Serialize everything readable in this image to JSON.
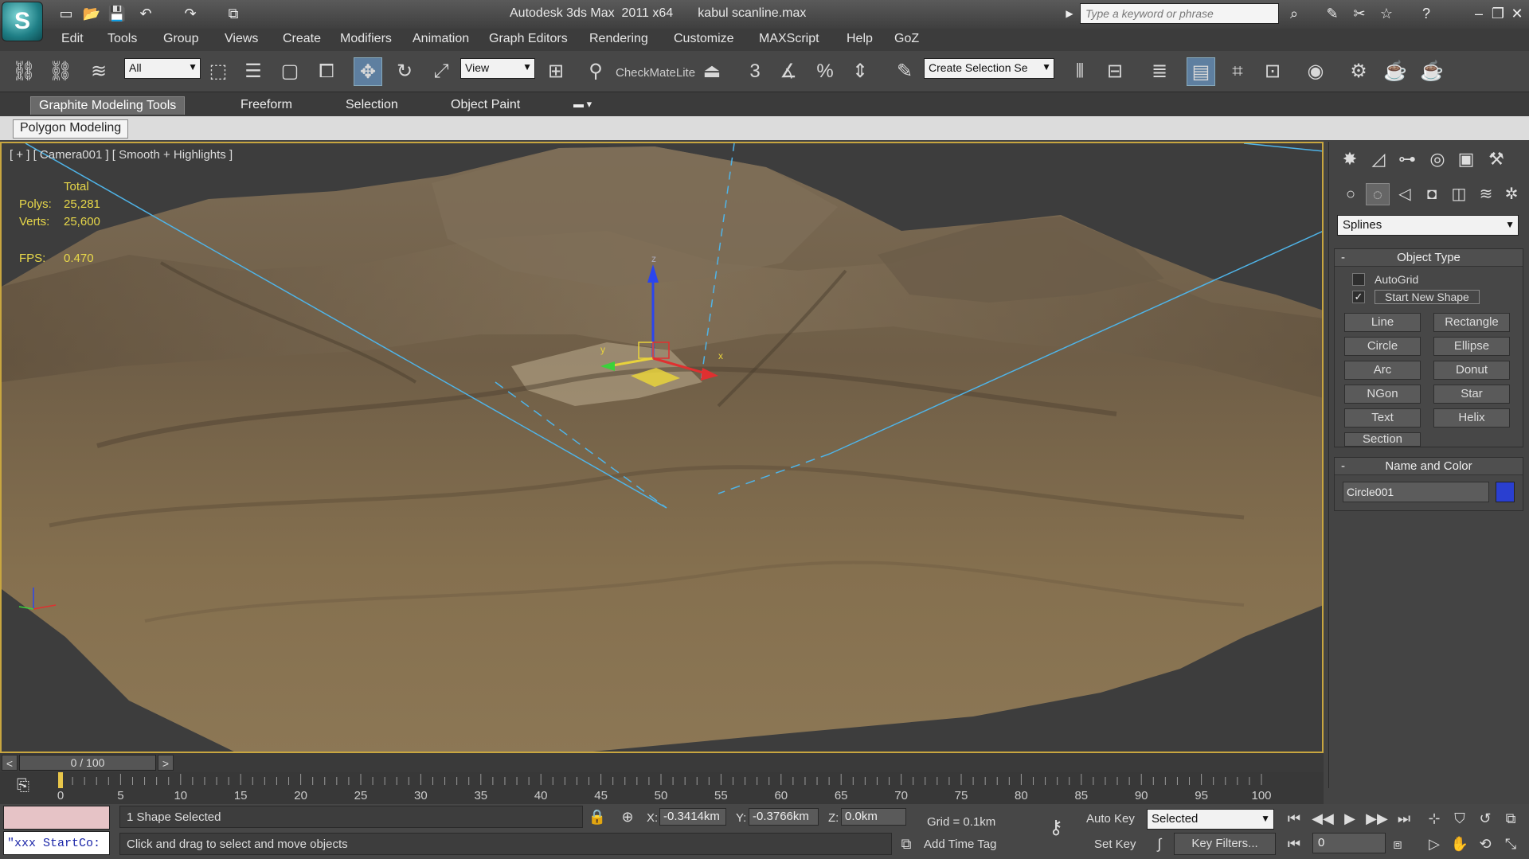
{
  "title_bar": {
    "logo_letter": "S",
    "app": "Autodesk 3ds Max  2011 x64",
    "file": "kabul scanline.max",
    "search_placeholder": "Type a keyword or phrase"
  },
  "menu": [
    "Edit",
    "Tools",
    "Group",
    "Views",
    "Create",
    "Modifiers",
    "Animation",
    "Graph Editors",
    "Rendering",
    "Customize",
    "MAXScript",
    "Help",
    "GoZ"
  ],
  "toolbar": {
    "selection_filter": "All",
    "ref_coord": "View",
    "checkmate_label": "CheckMateLite",
    "named_selection": "Create Selection Se",
    "snap_label": "3"
  },
  "ribbon": {
    "tabs": [
      "Graphite Modeling Tools",
      "Freeform",
      "Selection",
      "Object Paint"
    ],
    "active_tab": "Graphite Modeling Tools",
    "sub_tab": "Polygon Modeling"
  },
  "viewport": {
    "label": "[ + ] [ Camera001 ] [ Smooth + Highlights ]",
    "stats": {
      "total_label": "Total",
      "polys_label": "Polys:",
      "polys_value": "25,281",
      "verts_label": "Verts:",
      "verts_value": "25,600",
      "fps_label": "FPS:",
      "fps_value": "0.470"
    },
    "gizmo": {
      "x": "x",
      "y": "y",
      "z": "z"
    }
  },
  "command_panel": {
    "category": "Splines",
    "object_type": {
      "title": "Object Type",
      "autogrid": "AutoGrid",
      "autogrid_checked": false,
      "start_new_shape": "Start New Shape",
      "start_new_shape_checked": true,
      "buttons": [
        "Line",
        "Rectangle",
        "Circle",
        "Ellipse",
        "Arc",
        "Donut",
        "NGon",
        "Star",
        "Text",
        "Helix",
        "Section"
      ]
    },
    "name_and_color": {
      "title": "Name and Color",
      "name": "Circle001",
      "color": "#2a3fd0"
    }
  },
  "timeline": {
    "position": "0 / 100",
    "ticks": [
      "0",
      "5",
      "10",
      "15",
      "20",
      "25",
      "30",
      "35",
      "40",
      "45",
      "50",
      "55",
      "60",
      "65",
      "70",
      "75",
      "80",
      "85",
      "90",
      "95",
      "100"
    ]
  },
  "status": {
    "maxscript_text": "\"xxx StartCo:",
    "selection": "1 Shape Selected",
    "prompt": "Click and drag to select and move objects",
    "x_label": "X:",
    "x_value": "-0.3414km",
    "y_label": "Y:",
    "y_value": "-0.3766km",
    "z_label": "Z:",
    "z_value": "0.0km",
    "grid": "Grid = 0.1km",
    "add_time_tag": "Add Time Tag",
    "auto_key": "Auto Key",
    "set_key": "Set Key",
    "key_mode": "Selected",
    "key_filters": "Key Filters...",
    "frame": "0"
  }
}
